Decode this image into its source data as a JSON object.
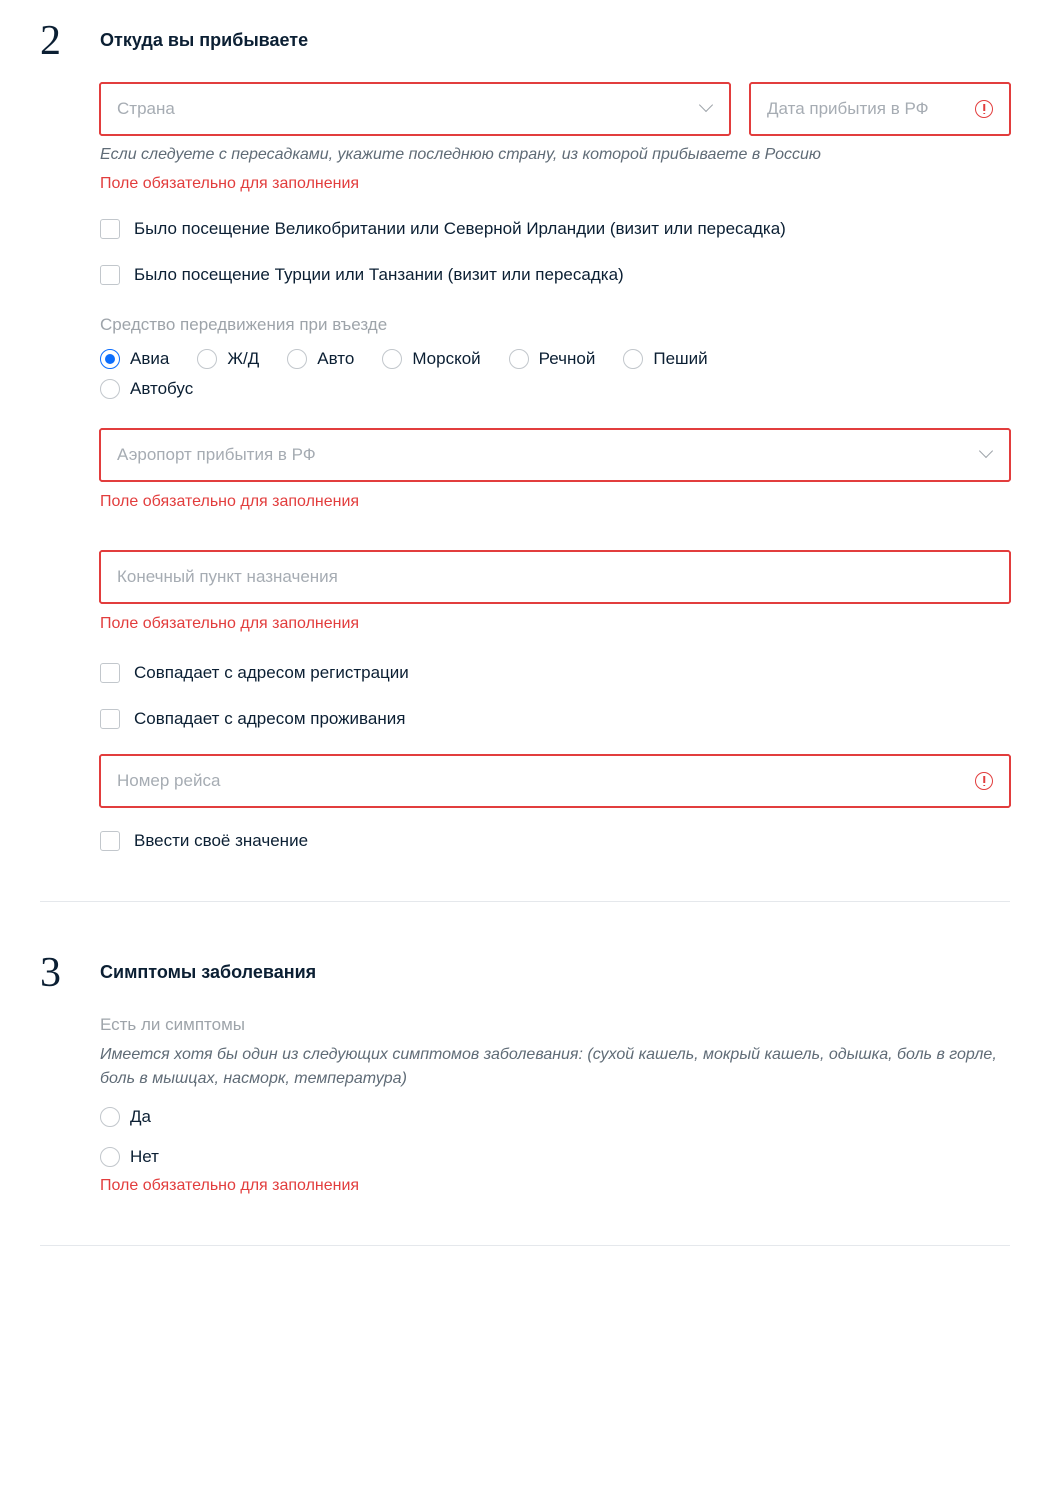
{
  "section2": {
    "number": "2",
    "title": "Откуда вы прибываете",
    "country": {
      "placeholder": "Страна"
    },
    "arrivalDate": {
      "placeholder": "Дата прибытия в РФ"
    },
    "transitHint": "Если следуете с пересадками, укажите последнюю страну, из которой прибываете в Россию",
    "requiredError": "Поле обязательно для заполнения",
    "visitedUK": "Было посещение Великобритании или Северной Ирландии (визит или пересадка)",
    "visitedTurkey": "Было посещение Турции или Танзании (визит или пересадка)",
    "transport": {
      "label": "Средство передвижения при въезде",
      "options": [
        "Авиа",
        "Ж/Д",
        "Авто",
        "Морской",
        "Речной",
        "Пеший",
        "Автобус"
      ],
      "selected": "Авиа"
    },
    "airport": {
      "placeholder": "Аэропорт прибытия в РФ"
    },
    "destination": {
      "placeholder": "Конечный пункт назначения"
    },
    "sameAsReg": "Совпадает с адресом регистрации",
    "sameAsLive": "Совпадает с адресом проживания",
    "flight": {
      "placeholder": "Номер рейса"
    },
    "customValue": "Ввести своё значение"
  },
  "section3": {
    "number": "3",
    "title": "Симптомы заболевания",
    "symptomsLabel": "Есть ли симптомы",
    "symptomsHint": "Имеется хотя бы один из следующих симптомов заболевания: (сухой кашель, мокрый кашель, одышка, боль в горле, боль в мышцах, насморк, температура)",
    "yes": "Да",
    "no": "Нет",
    "requiredError": "Поле обязательно для заполнения"
  }
}
